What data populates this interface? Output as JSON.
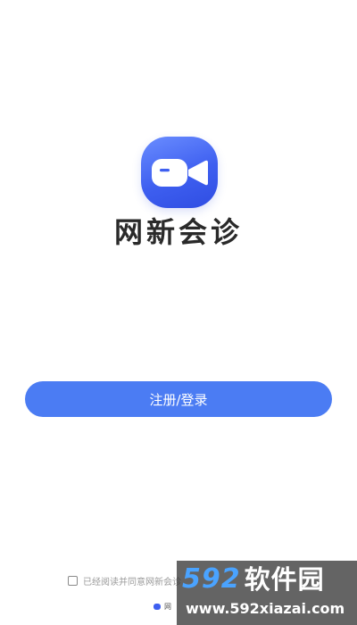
{
  "app": {
    "name": "网新会诊",
    "logo_icon": "video-camera-icon",
    "accent_color": "#4b7cf3"
  },
  "actions": {
    "register_login_label": "注册/登录"
  },
  "agreement": {
    "checked": false,
    "text": "已经阅读并同意网新会诊"
  },
  "footer": {
    "text": "网"
  },
  "watermark": {
    "number": "592",
    "name": "软件园",
    "url": "www.592xiazai.com"
  }
}
